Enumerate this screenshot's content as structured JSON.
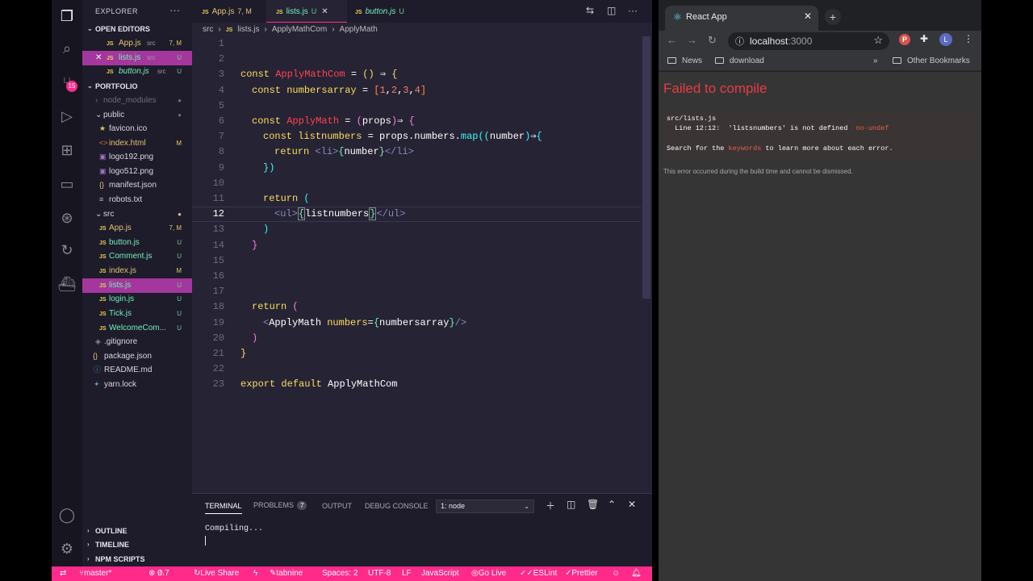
{
  "explorer": {
    "title": "EXPLORER",
    "open_editors": {
      "label": "OPEN EDITORS",
      "items": [
        {
          "name": "App.js",
          "dir": "src",
          "status": "7, M"
        },
        {
          "name": "lists.js",
          "dir": "src",
          "status": "U"
        },
        {
          "name": "button.js",
          "dir": "src",
          "status": "U"
        }
      ]
    },
    "project": {
      "label": "PORTFOLIO",
      "items": [
        {
          "name": "node_modules",
          "status": ""
        },
        {
          "name": "public",
          "status": ""
        },
        {
          "name": "favicon.ico",
          "status": ""
        },
        {
          "name": "index.html",
          "status": "M"
        },
        {
          "name": "logo192.png",
          "status": ""
        },
        {
          "name": "logo512.png",
          "status": ""
        },
        {
          "name": "manifest.json",
          "status": ""
        },
        {
          "name": "robots.txt",
          "status": ""
        },
        {
          "name": "src",
          "status": ""
        },
        {
          "name": "App.js",
          "status": "7, M"
        },
        {
          "name": "button.js",
          "status": "U"
        },
        {
          "name": "Comment.js",
          "status": "U"
        },
        {
          "name": "index.js",
          "status": "M"
        },
        {
          "name": "lists.js",
          "status": "U"
        },
        {
          "name": "login.js",
          "status": "U"
        },
        {
          "name": "Tick.js",
          "status": "U"
        },
        {
          "name": "WelcomeCom...",
          "status": "U"
        },
        {
          "name": ".gitignore",
          "status": ""
        },
        {
          "name": "package.json",
          "status": ""
        },
        {
          "name": "README.md",
          "status": ""
        },
        {
          "name": "yarn.lock",
          "status": ""
        }
      ]
    },
    "bottom_sections": [
      "OUTLINE",
      "TIMELINE",
      "NPM SCRIPTS"
    ]
  },
  "activity_badge": "15",
  "tabs": [
    {
      "name": "App.js",
      "status": "7, M"
    },
    {
      "name": "lists.js",
      "status": "U"
    },
    {
      "name": "button.js",
      "status": "U"
    }
  ],
  "breadcrumb": [
    "src",
    "lists.js",
    "ApplyMathCom",
    "ApplyMath"
  ],
  "editor": {
    "current_line": 12,
    "line_numbers": [
      "1",
      "2",
      "3",
      "4",
      "5",
      "6",
      "7",
      "8",
      "9",
      "10",
      "11",
      "12",
      "13",
      "14",
      "15",
      "16",
      "17",
      "18",
      "19",
      "20",
      "21",
      "22",
      "23"
    ]
  },
  "panel": {
    "tabs": {
      "terminal": "TERMINAL",
      "problems": "PROBLEMS",
      "output": "OUTPUT",
      "debug": "DEBUG CONSOLE"
    },
    "problems_count": "7",
    "selector": "1: node",
    "terminal_text": "Compiling..."
  },
  "statusbar": {
    "branch": "master*",
    "errors": "0",
    "warnings": "7",
    "live_share": "Live Share",
    "tabnine": "tabnine",
    "spaces": "Spaces: 2",
    "encoding": "UTF-8",
    "eol": "LF",
    "language": "JavaScript",
    "go_live": "Go Live",
    "eslint": "ESLint",
    "prettier": "Prettier"
  },
  "browser": {
    "tab_title": "React App",
    "url_host": "localhost",
    "url_port": ":3000",
    "profile_p": "P",
    "profile_l": "L",
    "bookmarks": [
      "News",
      "download"
    ],
    "overflow": "»",
    "other_bookmarks": "Other Bookmarks",
    "error_title": "Failed to compile",
    "error_file": "src/lists.js",
    "error_line_prefix": "  Line 12:12:  'listsnumbers' is not defined  ",
    "error_rule": "no-undef",
    "search_prefix": "Search for the ",
    "search_keyword": "keywords",
    "search_suffix": " to learn more about each error.",
    "note": "This error occurred during the build time and cannot be dismissed."
  }
}
